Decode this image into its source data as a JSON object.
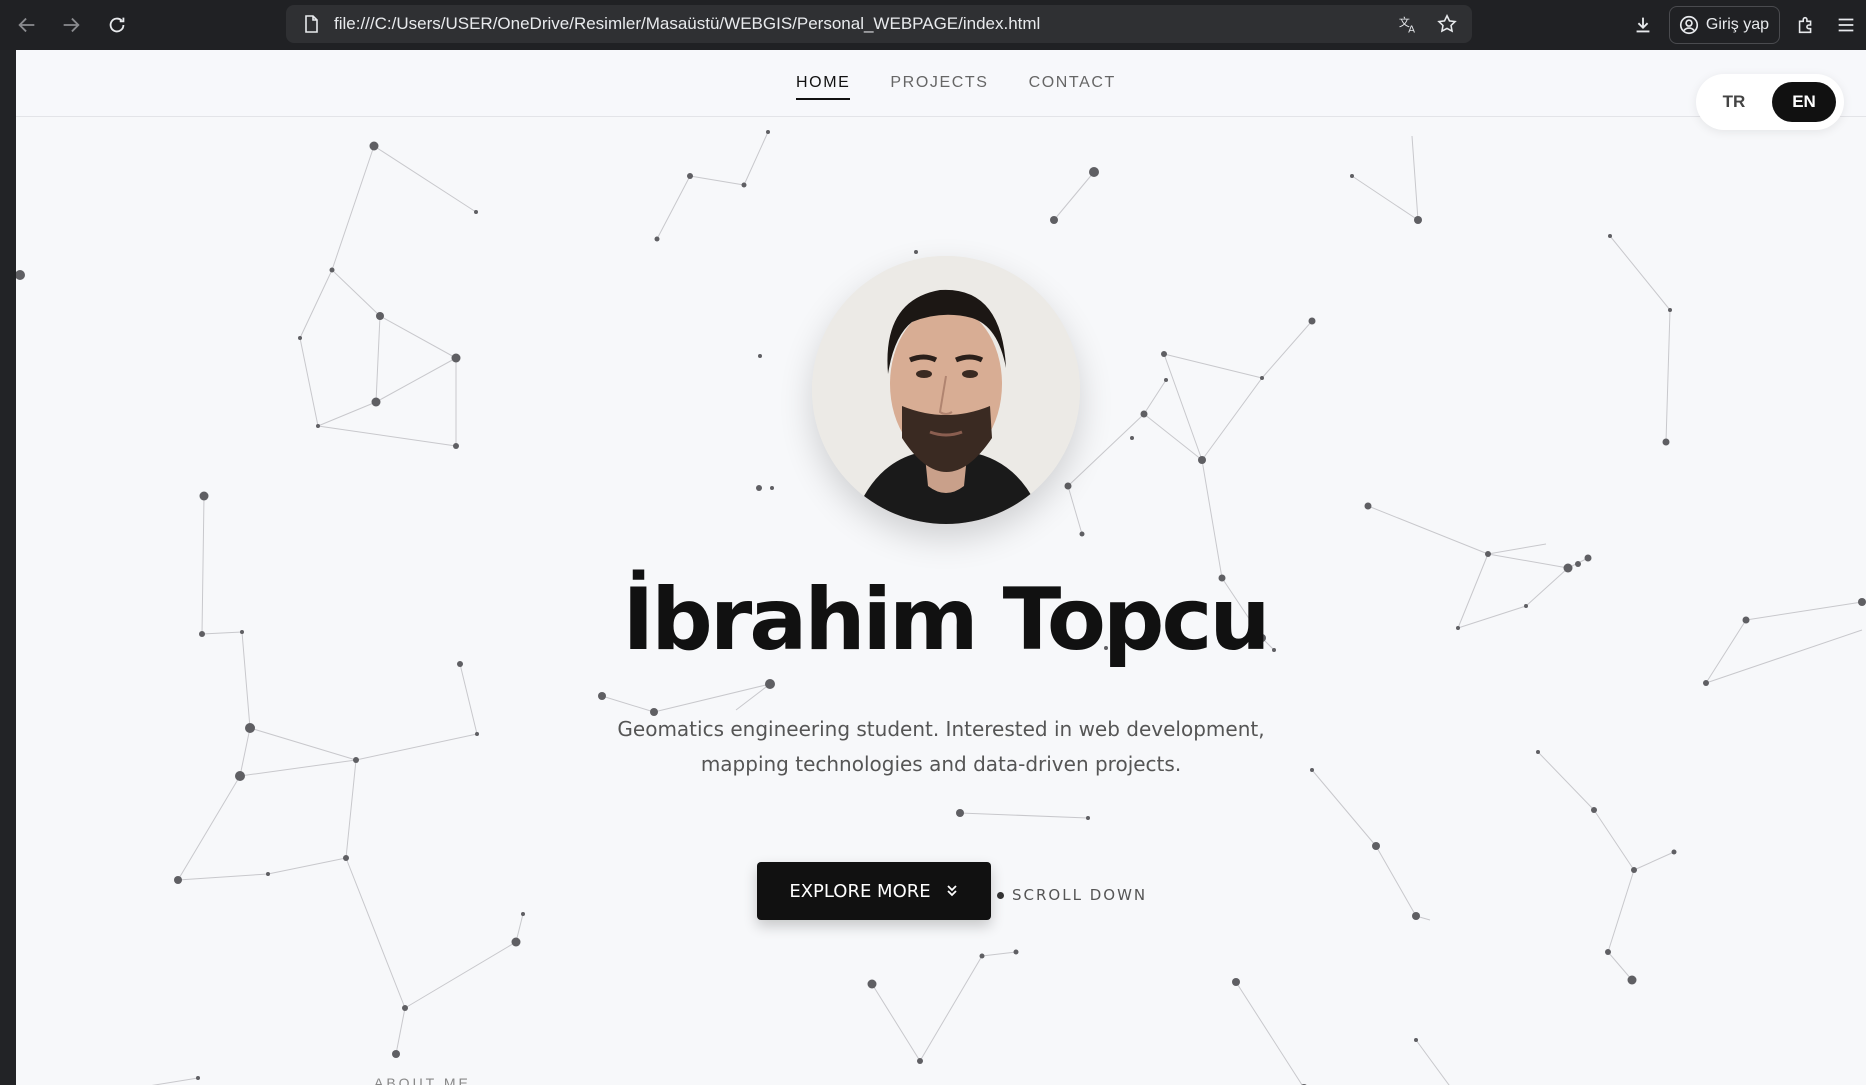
{
  "browser": {
    "url": "file:///C:/Users/USER/OneDrive/Resimler/Masaüstü/WEBGIS/Personal_WEBPAGE/index.html",
    "signin_label": "Giriş yap"
  },
  "nav": {
    "items": [
      "HOME",
      "PROJECTS",
      "CONTACT"
    ],
    "active": "HOME"
  },
  "lang": {
    "tr": "TR",
    "en": "EN",
    "selected": "EN"
  },
  "hero": {
    "name": "İbrahim Topcu",
    "tagline": "Geomatics engineering student. Interested in web development, mapping technologies and data-driven projects.",
    "button_label": "EXPLORE MORE",
    "scroll_label": "SCROLL DOWN"
  },
  "next_section": "ABOUT ME",
  "colors": {
    "accent": "#111111",
    "background": "#f7f8fa",
    "chrome": "#202124"
  }
}
